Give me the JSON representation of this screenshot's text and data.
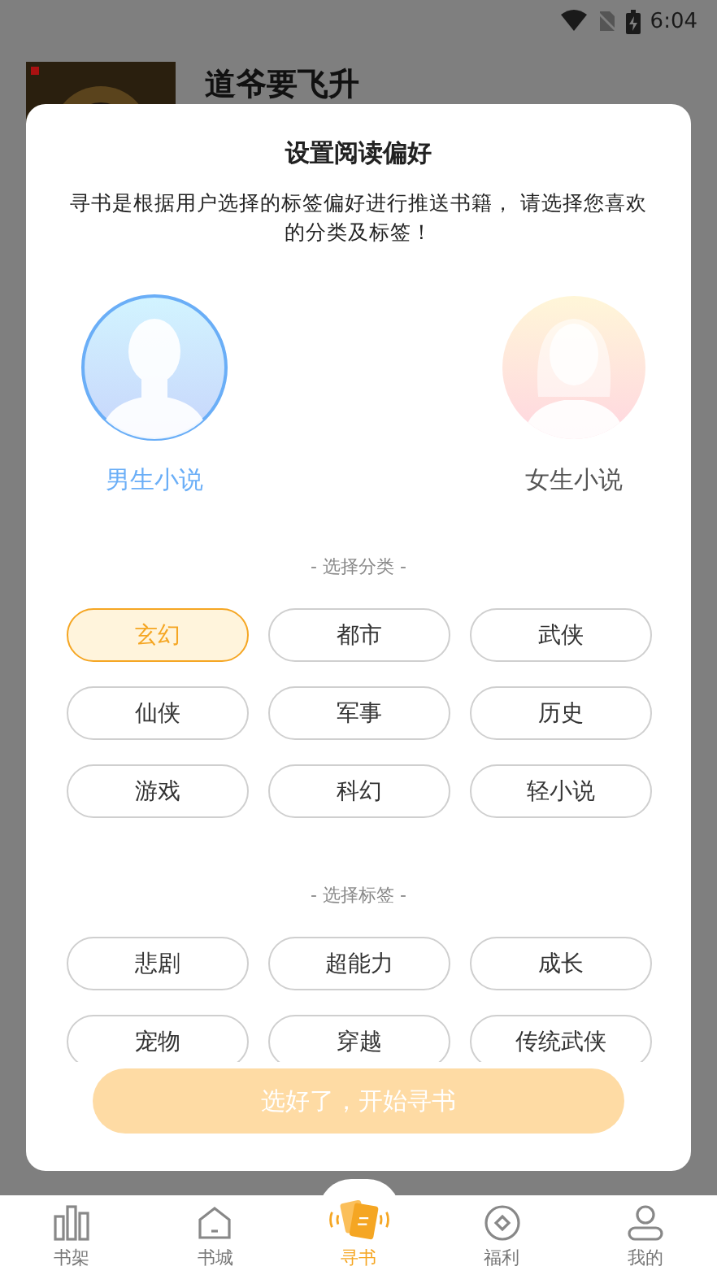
{
  "status_bar": {
    "time": "6:04"
  },
  "book": {
    "title": "道爷要飞升"
  },
  "dialog": {
    "title": "设置阅读偏好",
    "description": "寻书是根据用户选择的标签偏好进行推送书籍， 请选择您喜欢的分类及标签！",
    "genders": [
      {
        "kind": "male",
        "label": "男生小说",
        "selected": true
      },
      {
        "kind": "female",
        "label": "女生小说",
        "selected": false
      }
    ],
    "category_heading": "- 选择分类 -",
    "categories": [
      {
        "label": "玄幻",
        "selected": true
      },
      {
        "label": "都市",
        "selected": false
      },
      {
        "label": "武侠",
        "selected": false
      },
      {
        "label": "仙侠",
        "selected": false
      },
      {
        "label": "军事",
        "selected": false
      },
      {
        "label": "历史",
        "selected": false
      },
      {
        "label": "游戏",
        "selected": false
      },
      {
        "label": "科幻",
        "selected": false
      },
      {
        "label": "轻小说",
        "selected": false
      }
    ],
    "tag_heading": "- 选择标签 -",
    "tags": [
      {
        "label": "悲剧",
        "selected": false
      },
      {
        "label": "超能力",
        "selected": false
      },
      {
        "label": "成长",
        "selected": false
      },
      {
        "label": "宠物",
        "selected": false
      },
      {
        "label": "穿越",
        "selected": false
      },
      {
        "label": "传统武侠",
        "selected": false
      }
    ],
    "confirm_button": {
      "label": "选好了，开始寻书",
      "disabled": true
    }
  },
  "bottom_nav": [
    {
      "kind": "shelf",
      "label": "书架",
      "selected": false
    },
    {
      "kind": "store",
      "label": "书城",
      "selected": false
    },
    {
      "kind": "find",
      "label": "寻书",
      "selected": true
    },
    {
      "kind": "welfare",
      "label": "福利",
      "selected": false
    },
    {
      "kind": "me",
      "label": "我的",
      "selected": false
    }
  ]
}
